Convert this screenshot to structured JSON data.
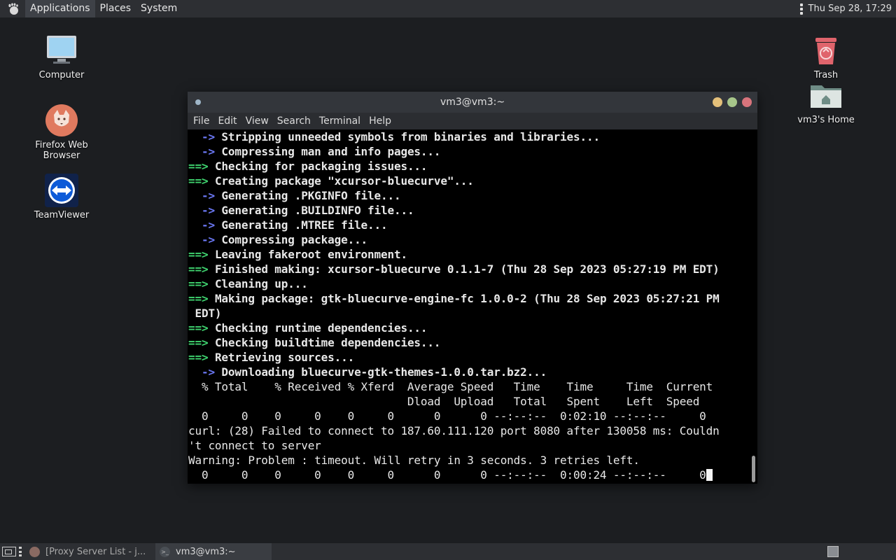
{
  "top_panel": {
    "menus": [
      "Applications",
      "Places",
      "System"
    ],
    "clock": "Thu Sep 28, 17:29"
  },
  "desktop_icons": {
    "computer": "Computer",
    "firefox": "Firefox Web Browser",
    "teamviewer": "TeamViewer",
    "trash": "Trash",
    "home": "vm3's Home"
  },
  "terminal": {
    "title": "vm3@vm3:~",
    "menus": [
      "File",
      "Edit",
      "View",
      "Search",
      "Terminal",
      "Help"
    ],
    "lines": [
      {
        "prefix": "  -> ",
        "kind": "blue",
        "text": "Stripping unneeded symbols from binaries and libraries..."
      },
      {
        "prefix": "  -> ",
        "kind": "blue",
        "text": "Compressing man and info pages..."
      },
      {
        "prefix": "==> ",
        "kind": "green",
        "text": "Checking for packaging issues..."
      },
      {
        "prefix": "==> ",
        "kind": "green",
        "text": "Creating package \"xcursor-bluecurve\"..."
      },
      {
        "prefix": "  -> ",
        "kind": "blue",
        "text": "Generating .PKGINFO file..."
      },
      {
        "prefix": "  -> ",
        "kind": "blue",
        "text": "Generating .BUILDINFO file..."
      },
      {
        "prefix": "  -> ",
        "kind": "blue",
        "text": "Generating .MTREE file..."
      },
      {
        "prefix": "  -> ",
        "kind": "blue",
        "text": "Compressing package..."
      },
      {
        "prefix": "==> ",
        "kind": "green",
        "text": "Leaving fakeroot environment."
      },
      {
        "prefix": "==> ",
        "kind": "green",
        "text": "Finished making: xcursor-bluecurve 0.1.1-7 (Thu 28 Sep 2023 05:27:19 PM EDT)"
      },
      {
        "prefix": "==> ",
        "kind": "green",
        "text": "Cleaning up..."
      },
      {
        "prefix": "==> ",
        "kind": "green",
        "text": "Making package: gtk-bluecurve-engine-fc 1.0.0-2 (Thu 28 Sep 2023 05:27:21 PM"
      },
      {
        "prefix": "",
        "kind": "bold",
        "text": " EDT)"
      },
      {
        "prefix": "==> ",
        "kind": "green",
        "text": "Checking runtime dependencies..."
      },
      {
        "prefix": "==> ",
        "kind": "green",
        "text": "Checking buildtime dependencies..."
      },
      {
        "prefix": "==> ",
        "kind": "green",
        "text": "Retrieving sources..."
      },
      {
        "prefix": "  -> ",
        "kind": "blue",
        "text": "Downloading bluecurve-gtk-themes-1.0.0.tar.bz2..."
      },
      {
        "prefix": "",
        "kind": "plain",
        "text": "  % Total    % Received % Xferd  Average Speed   Time    Time     Time  Current"
      },
      {
        "prefix": "",
        "kind": "plain",
        "text": "                                 Dload  Upload   Total   Spent    Left  Speed"
      },
      {
        "prefix": "",
        "kind": "plain",
        "text": "  0     0    0     0    0     0      0      0 --:--:--  0:02:10 --:--:--     0"
      },
      {
        "prefix": "",
        "kind": "plain",
        "text": "curl: (28) Failed to connect to 187.60.111.120 port 8080 after 130058 ms: Couldn"
      },
      {
        "prefix": "",
        "kind": "plain",
        "text": "'t connect to server"
      },
      {
        "prefix": "",
        "kind": "plain",
        "text": "Warning: Problem : timeout. Will retry in 3 seconds. 3 retries left."
      },
      {
        "prefix": "",
        "kind": "plain",
        "text": "  0     0    0     0    0     0      0      0 --:--:--  0:00:24 --:--:--     0",
        "cursor": true
      }
    ]
  },
  "bottom_panel": {
    "tasks": [
      {
        "label": "[Proxy Server List - j...",
        "active": false
      },
      {
        "label": "vm3@vm3:~",
        "active": true
      }
    ]
  }
}
